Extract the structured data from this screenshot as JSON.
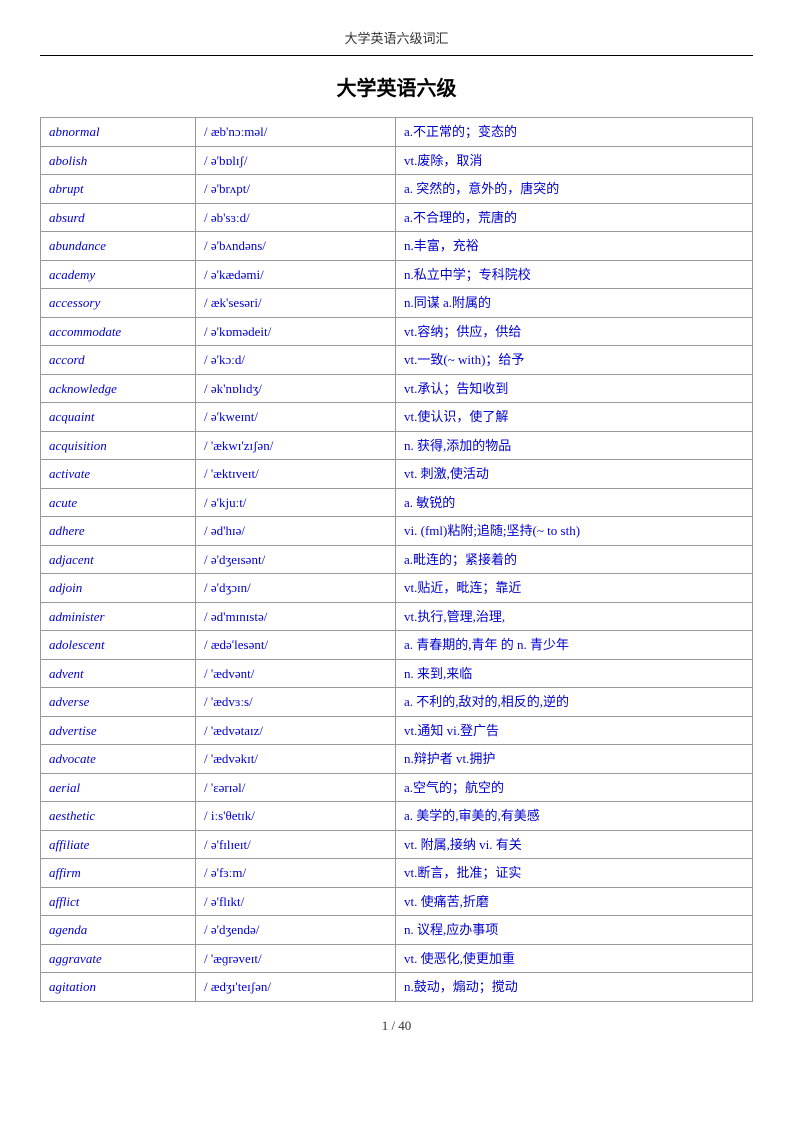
{
  "header": {
    "title": "大学英语六级词汇"
  },
  "page_title": "大学英语六级",
  "rows": [
    {
      "word": "abnormal",
      "phonetic": "/ æb'nɔːməl/",
      "definition": "a.不正常的；变态的"
    },
    {
      "word": "abolish",
      "phonetic": "/ ə'bɒlɪʃ/",
      "definition": "vt.废除，取消"
    },
    {
      "word": "abrupt",
      "phonetic": "/ ə'brʌpt/",
      "definition": "a. 突然的，意外的，唐突的"
    },
    {
      "word": "absurd",
      "phonetic": "/ əb'sɜːd/",
      "definition": "a.不合理的，荒唐的"
    },
    {
      "word": "abundance",
      "phonetic": "/ ə'bʌndəns/",
      "definition": "n.丰富，充裕"
    },
    {
      "word": "academy",
      "phonetic": "/ ə'kædəmi/",
      "definition": "n.私立中学；专科院校"
    },
    {
      "word": "accessory",
      "phonetic": "/ æk'sesəri/",
      "definition": "n.同谋 a.附属的"
    },
    {
      "word": "accommodate",
      "phonetic": "/ ə'kɒmədeit/",
      "definition": "vt.容纳；供应，供给"
    },
    {
      "word": "accord",
      "phonetic": "/ ə'kɔːd/",
      "definition": "vt.一致(~ with)；给予"
    },
    {
      "word": "acknowledge",
      "phonetic": "/ ək'nɒlɪdʒ/",
      "definition": "vt.承认；告知收到"
    },
    {
      "word": "acquaint",
      "phonetic": "/ ə'kweɪnt/",
      "definition": "vt.使认识，使了解"
    },
    {
      "word": "acquisition",
      "phonetic": "/ 'ækwɪ'zɪʃən/",
      "definition": "n. 获得,添加的物品"
    },
    {
      "word": "activate",
      "phonetic": "/ 'æktɪveɪt/",
      "definition": "vt. 刺激,使活动"
    },
    {
      "word": "acute",
      "phonetic": "/ ə'kjuːt/",
      "definition": "a. 敏锐的"
    },
    {
      "word": "adhere",
      "phonetic": "/ əd'hɪə/",
      "definition": "vi. (fml)粘附;追随;坚持(~ to sth)"
    },
    {
      "word": "adjacent",
      "phonetic": "/ ə'dʒeɪsənt/",
      "definition": "a.毗连的；紧接着的"
    },
    {
      "word": "adjoin",
      "phonetic": "/ ə'dʒɔɪn/",
      "definition": "vt.贴近，毗连；靠近"
    },
    {
      "word": "administer",
      "phonetic": "/ əd'mɪnɪstə/",
      "definition": "vt.执行,管理,治理,"
    },
    {
      "word": "adolescent",
      "phonetic": "/ ædə'lesənt/",
      "definition": "a. 青春期的,青年 的 n. 青少年"
    },
    {
      "word": "advent",
      "phonetic": "/ 'ædvənt/",
      "definition": "n. 来到,来临"
    },
    {
      "word": "adverse",
      "phonetic": "/ 'ædvɜːs/",
      "definition": "a. 不利的,敌对的,相反的,逆的"
    },
    {
      "word": "advertise",
      "phonetic": "/ 'ædvətaɪz/",
      "definition": "vt.通知 vi.登广告"
    },
    {
      "word": "advocate",
      "phonetic": "/ 'ædvəkɪt/",
      "definition": "n.辩护者 vt.拥护"
    },
    {
      "word": "aerial",
      "phonetic": "/ 'ɛərɪəl/",
      "definition": "a.空气的；航空的"
    },
    {
      "word": "aesthetic",
      "phonetic": "/ iːs'θetɪk/",
      "definition": "a. 美学的,审美的,有美感"
    },
    {
      "word": "affiliate",
      "phonetic": "/ ə'fɪlɪeɪt/",
      "definition": "vt. 附属,接纳 vi. 有关"
    },
    {
      "word": "affirm",
      "phonetic": "/ ə'fɜːm/",
      "definition": "vt.断言，批准；证实"
    },
    {
      "word": "afflict",
      "phonetic": "/ ə'flɪkt/",
      "definition": "vt. 使痛苦,折磨"
    },
    {
      "word": "agenda",
      "phonetic": "/ ə'dʒendə/",
      "definition": "n. 议程,应办事项"
    },
    {
      "word": "aggravate",
      "phonetic": "/ 'æɡrəveɪt/",
      "definition": "vt. 使恶化,使更加重"
    },
    {
      "word": "agitation",
      "phonetic": "/ ædʒɪ'teɪʃən/",
      "definition": "n.鼓动，煽动；搅动"
    }
  ],
  "footer": {
    "text": "1 / 40"
  }
}
